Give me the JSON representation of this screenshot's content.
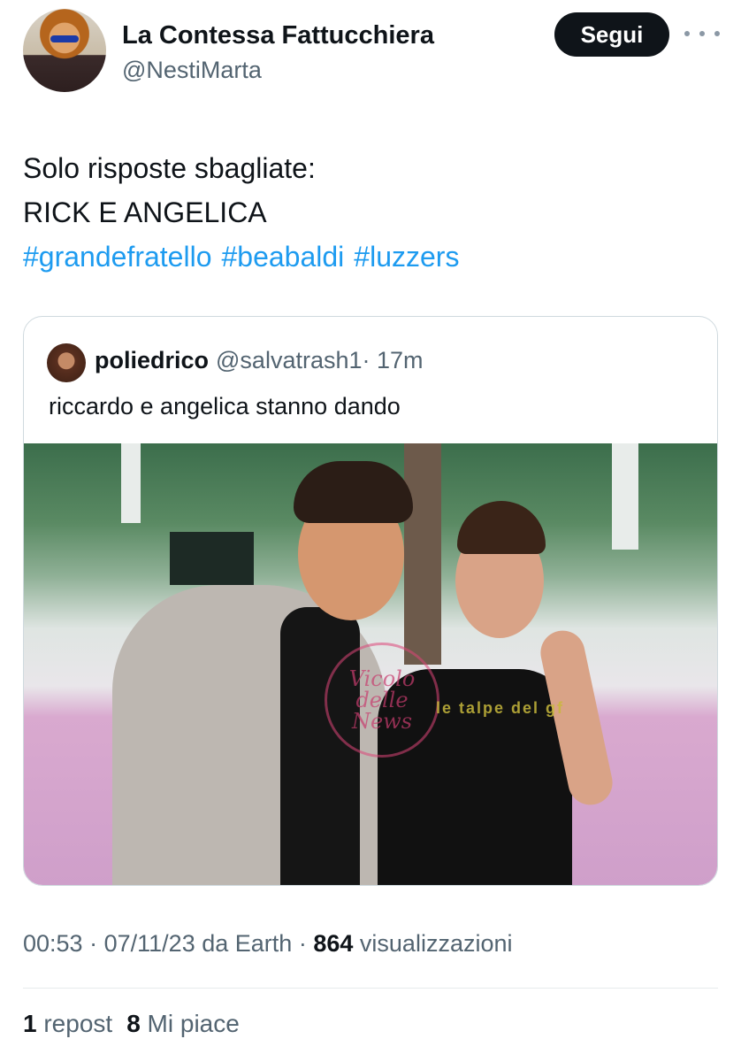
{
  "author": {
    "name": "La Contessa Fattucchiera",
    "handle": "@NestiMarta",
    "follow_label": "Segui"
  },
  "tweet": {
    "lines": [
      "Solo risposte sbagliate:",
      "RICK E ANGELICA"
    ],
    "hashtags": [
      "#grandefratello",
      "#beabaldi",
      "#luzzers"
    ]
  },
  "quoted": {
    "name": "poliedrico",
    "handle": "@salvatrash1",
    "time": "· 17m",
    "text": "riccardo e angelica stanno dando",
    "watermark_circle": "Vicolo delle News",
    "watermark_text": "le talpe del gf"
  },
  "meta": {
    "time": "00:53",
    "date": "07/11/23",
    "source": "da Earth",
    "views_count": "864",
    "views_label": "visualizzazioni"
  },
  "stats": {
    "reposts_count": "1",
    "reposts_label": "repost",
    "likes_count": "8",
    "likes_label": "Mi piace"
  }
}
